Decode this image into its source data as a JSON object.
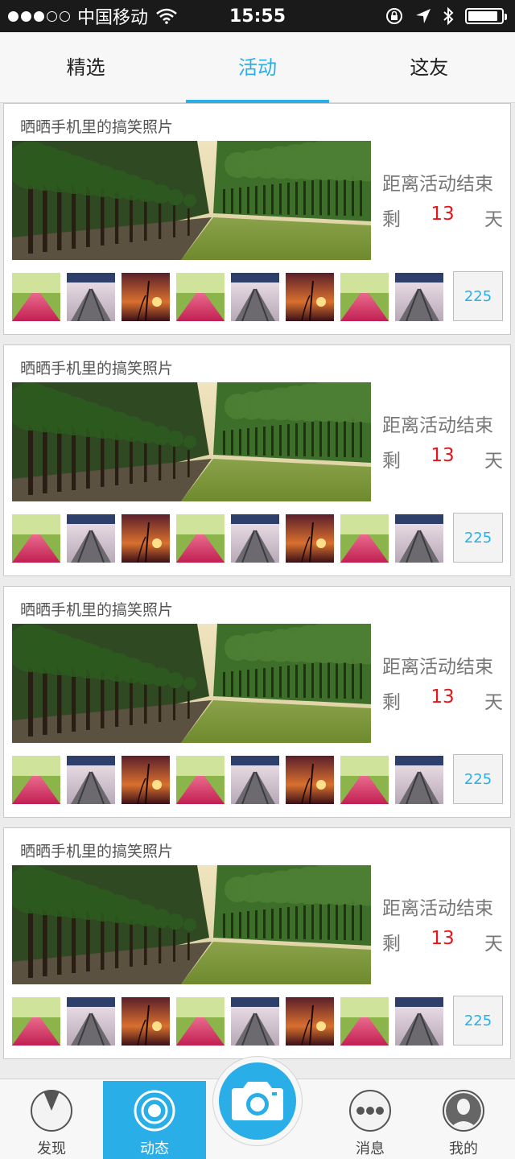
{
  "status_bar": {
    "carrier": "中国移动",
    "time": "15:55",
    "signal_filled": 3,
    "signal_total": 5,
    "battery_level": 0.9,
    "icons": [
      "wifi-icon",
      "rotation-lock-icon",
      "location-icon",
      "bluetooth-icon",
      "battery-icon"
    ]
  },
  "tabs": [
    {
      "label": "精选",
      "active": false
    },
    {
      "label": "活动",
      "active": true
    },
    {
      "label": "这友",
      "active": false
    }
  ],
  "cards": [
    {
      "title": "晒晒手机里的搞笑照片",
      "countdown_label": "距离活动结束",
      "remaining_prefix": "剩",
      "days": "13",
      "days_unit": "天",
      "count": "225"
    },
    {
      "title": "晒晒手机里的搞笑照片",
      "countdown_label": "距离活动结束",
      "remaining_prefix": "剩",
      "days": "13",
      "days_unit": "天",
      "count": "225"
    },
    {
      "title": "晒晒手机里的搞笑照片",
      "countdown_label": "距离活动结束",
      "remaining_prefix": "剩",
      "days": "13",
      "days_unit": "天",
      "count": "225"
    },
    {
      "title": "晒晒手机里的搞笑照片",
      "countdown_label": "距离活动结束",
      "remaining_prefix": "剩",
      "days": "13",
      "days_unit": "天",
      "count": "225"
    }
  ],
  "thumbnail_pattern": [
    "pink-road-photo",
    "railway-blossom-photo",
    "sunset-grass-photo",
    "pink-road-photo",
    "railway-blossom-photo",
    "sunset-grass-photo",
    "pink-road-photo",
    "railway-blossom-photo"
  ],
  "bottom_nav": {
    "discover": {
      "label": "发现",
      "icon": "compass-icon"
    },
    "feed": {
      "label": "动态",
      "icon": "target-icon",
      "active": true
    },
    "camera": {
      "icon": "camera-icon"
    },
    "messages": {
      "label": "消息",
      "icon": "chat-dots-icon"
    },
    "profile": {
      "label": "我的",
      "icon": "user-avatar-icon"
    }
  },
  "colors": {
    "accent": "#2aaee8",
    "countdown_number": "#e2161b",
    "status_bar_bg": "#1a1a1a"
  }
}
